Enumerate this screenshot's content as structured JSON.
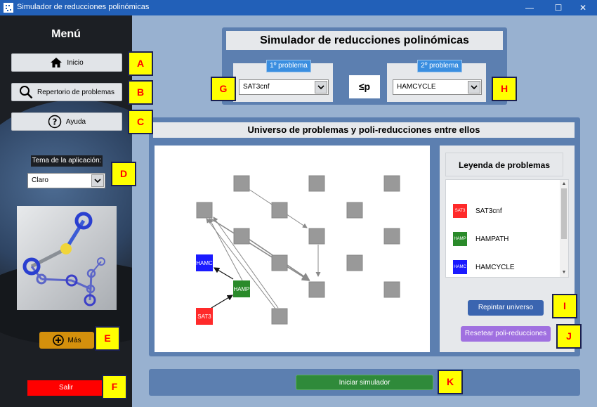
{
  "window": {
    "title": "Simulador de reducciones polinómicas",
    "minimize_glyph": "—",
    "maximize_glyph": "☐",
    "close_glyph": "✕"
  },
  "sidebar": {
    "menu_title": "Menú",
    "buttons": {
      "inicio": "Inicio",
      "repertorio": "Repertorio de problemas",
      "ayuda": "Ayuda"
    },
    "theme_label": "Tema de la aplicación:",
    "theme_value": "Claro",
    "mas_label": "Más",
    "salir_label": "Salir"
  },
  "header": {
    "title": "Simulador de reducciones polinómicas",
    "problem1_label": "1º problema",
    "problem1_value": "SAT3cnf",
    "leq_symbol": "≤p",
    "problem2_label": "2º problema",
    "problem2_value": "HAMCYCLE"
  },
  "universe": {
    "title": "Universo de problemas y poli-reducciones entre ellos",
    "nodes": {
      "hamc": "HAMC",
      "hamp": "HAMP",
      "sat3": "SAT3"
    }
  },
  "legend": {
    "title": "Leyenda de problemas",
    "items": [
      {
        "abbr": "SAT3",
        "name": "SAT3cnf",
        "color": "#ff2a2a"
      },
      {
        "abbr": "HAMP",
        "name": "HAMPATH",
        "color": "#2a8a2a"
      },
      {
        "abbr": "HAMC",
        "name": "HAMCYCLE",
        "color": "#1a1aff"
      }
    ],
    "repintar_label": "Repintar universo",
    "resetear_label": "Resetear poli-reducciones"
  },
  "bottom": {
    "iniciar_label": "Iniciar simulador"
  },
  "annotations": [
    "A",
    "B",
    "C",
    "D",
    "E",
    "F",
    "G",
    "H",
    "I",
    "J",
    "K"
  ],
  "colors": {
    "titlebar": "#2260b8",
    "sidebar": "#1c1f24",
    "main_bg": "#98b1d0",
    "panel": "#5c7fb0",
    "problem_label": "#3a8ee0",
    "salir": "#ff0000",
    "mas": "#d4900c",
    "iniciar": "#2f8a3a",
    "repintar": "#3b65b0",
    "resetear": "#a070e0",
    "tag_bg": "#ffff00",
    "tag_text": "#ff0000"
  }
}
